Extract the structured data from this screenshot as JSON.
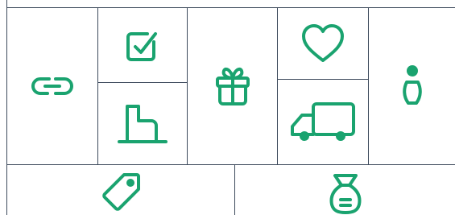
{
  "theme": {
    "accent": "#1aa36f",
    "grid_line": "#3d4a5c",
    "background": "#ffffff"
  },
  "icons": [
    {
      "name": "link-icon"
    },
    {
      "name": "checkbox-icon"
    },
    {
      "name": "chair-icon"
    },
    {
      "name": "gift-icon"
    },
    {
      "name": "heart-icon"
    },
    {
      "name": "delivery-truck-icon"
    },
    {
      "name": "person-icon"
    },
    {
      "name": "price-tag-icon"
    },
    {
      "name": "money-bag-icon"
    }
  ]
}
